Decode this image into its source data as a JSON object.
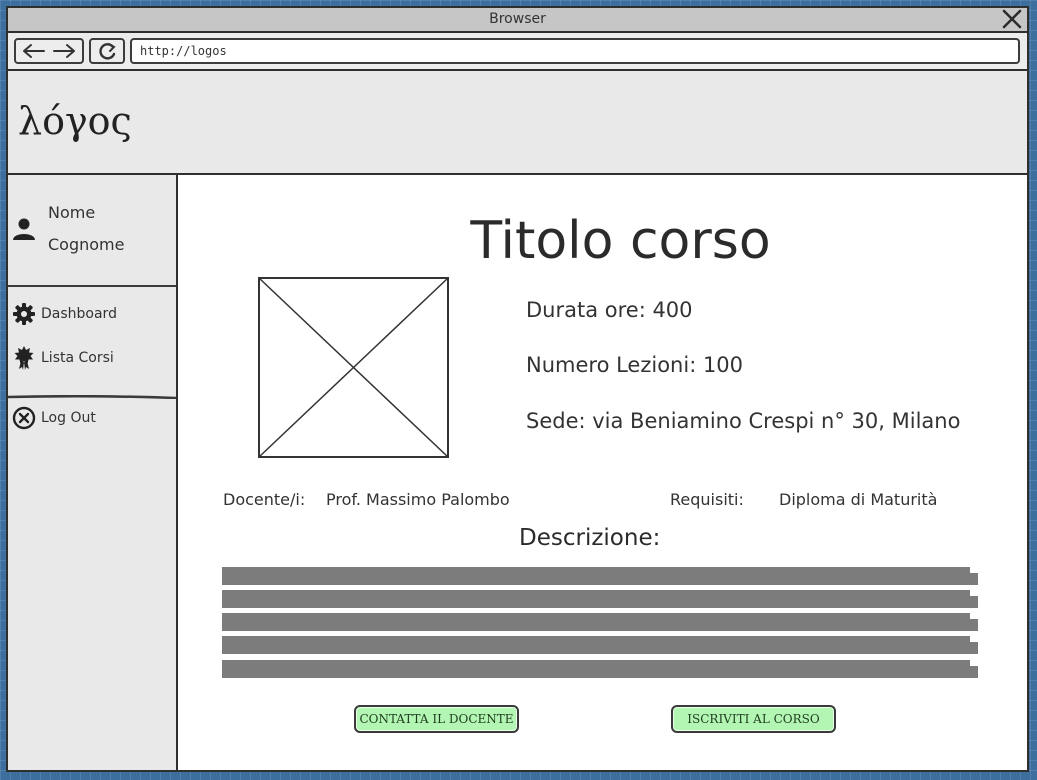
{
  "browser": {
    "title": "Browser",
    "url": "http://logos"
  },
  "header": {
    "logo": "λόγος"
  },
  "sidebar": {
    "user": {
      "first_name": "Nome",
      "last_name": "Cognome"
    },
    "items": [
      {
        "label": "Dashboard",
        "icon": "gear-icon"
      },
      {
        "label": "Lista Corsi",
        "icon": "badge-icon"
      },
      {
        "label": "Log Out",
        "icon": "close-circle-icon"
      }
    ]
  },
  "course": {
    "title": "Titolo corso",
    "duration": "Durata ore: 400",
    "lessons": "Numero Lezioni: 100",
    "location": "Sede: via Beniamino Crespi n° 30, Milano",
    "teacher_label": "Docente/i:",
    "teacher_value": "Prof. Massimo Palombo",
    "requirements_label": "Requisiti:",
    "requirements_value": "Diploma di Maturità",
    "description_heading": "Descrizione:"
  },
  "actions": {
    "contact": "CONTATTA IL DOCENTE",
    "enroll": "ISCRIVITI AL CORSO"
  },
  "colors": {
    "button_bg": "#b3f5b3",
    "text_placeholder_bar": "#7c7c7c",
    "header_bg": "#e9e9e9"
  }
}
